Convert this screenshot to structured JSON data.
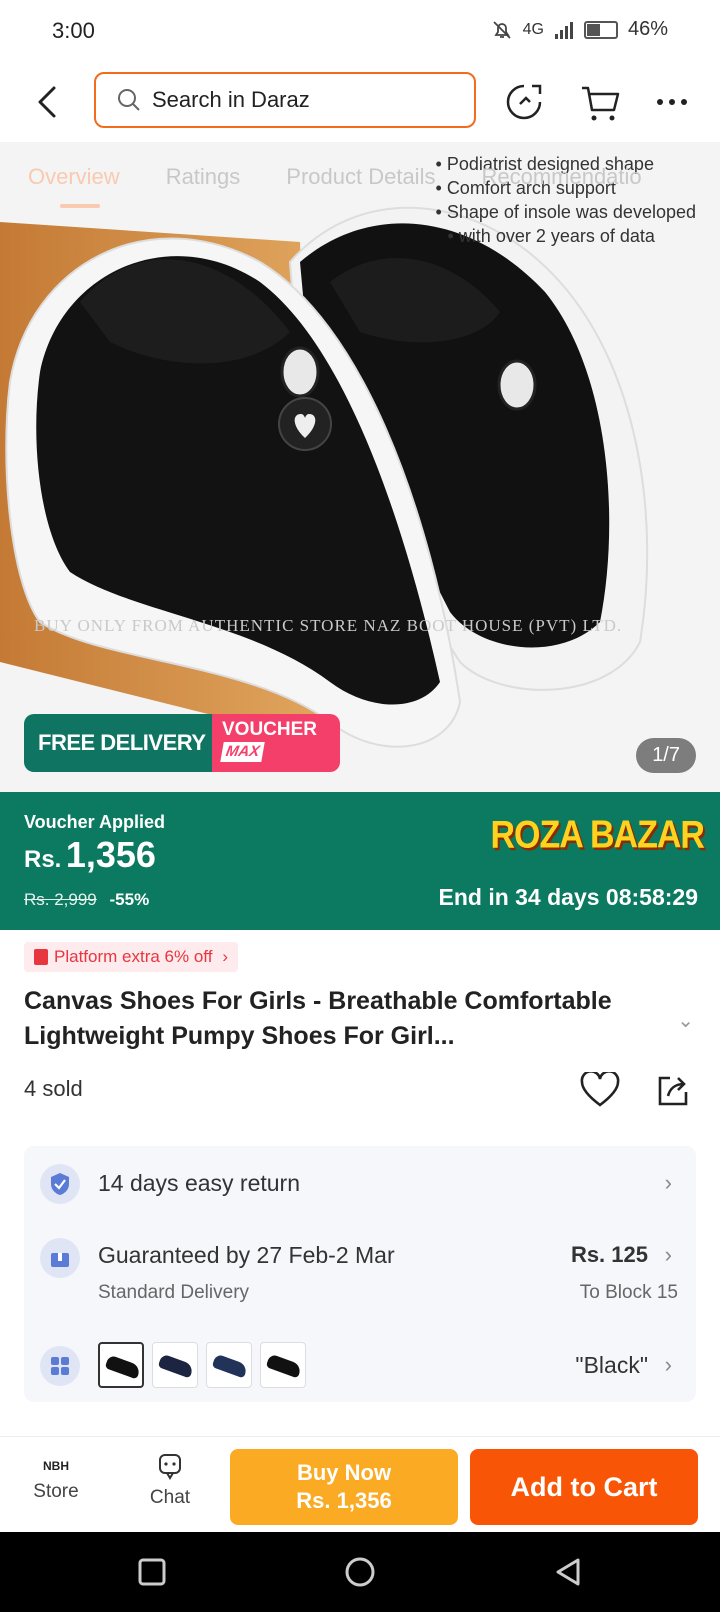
{
  "status": {
    "time": "3:00",
    "network": "4G",
    "battery": "46%",
    "battery_level": 0.46
  },
  "header": {
    "search_placeholder": "Search in Daraz"
  },
  "hero": {
    "tabs": [
      "Overview",
      "Ratings",
      "Product Details",
      "Recommendatio"
    ],
    "bullets": [
      "Podiatrist designed shape",
      "Comfort arch support",
      "Shape of insole was developed",
      "with over 2   years of data"
    ],
    "watermark": "BUY ONLY FROM AUTHENTIC STORE NAZ BOOT HOUSE (PVT) LTD.",
    "free_delivery": "FREE DELIVERY",
    "voucher_label": "VOUCHER",
    "voucher_max": "MAX",
    "page_count": "1/7"
  },
  "voucher": {
    "label": "Voucher Applied",
    "currency": "Rs.",
    "price": "1,356",
    "old_price": "Rs. 2,999",
    "discount": "-55%",
    "brand": "ROZA BAZAR",
    "ends": "End in 34 days 08:58:29"
  },
  "product": {
    "platform_tag": "Platform extra 6% off",
    "title": "Canvas Shoes For Girls - Breathable Comfortable Lightweight Pumpy Shoes For Girl...",
    "sold": "4 sold"
  },
  "info": {
    "return": "14 days easy return",
    "delivery": "Guaranteed by 27 Feb-2 Mar",
    "delivery_type": "Standard Delivery",
    "delivery_price": "Rs. 125",
    "delivery_to": "To Block 15",
    "variant": "\"Black\""
  },
  "bottom": {
    "store_logo": "NBH",
    "store": "Store",
    "chat": "Chat",
    "buy_now": "Buy Now",
    "buy_now_price": "Rs. 1,356",
    "add_to_cart": "Add to Cart"
  },
  "colors": {
    "accent": "#f85606",
    "buy_now": "#fbaa23",
    "voucher_bg": "#0b7a60",
    "brand_yellow": "#ffd21f"
  }
}
